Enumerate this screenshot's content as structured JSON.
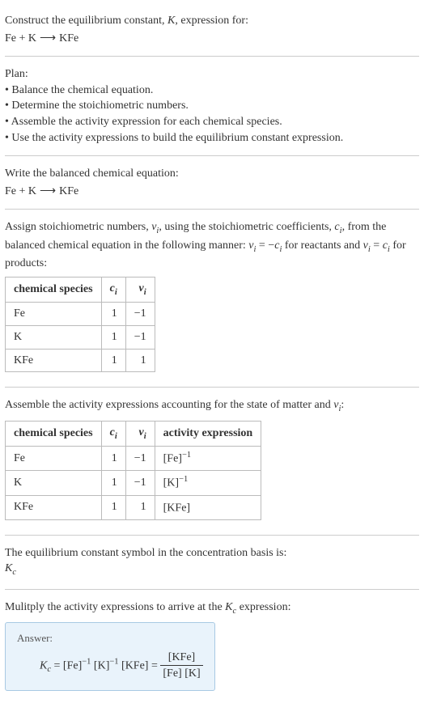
{
  "intro": {
    "line1_pre": "Construct the equilibrium constant, ",
    "line1_var": "K",
    "line1_post": ", expression for:",
    "eq_lhs1": "Fe",
    "eq_plus": " + ",
    "eq_lhs2": "K",
    "eq_arrow": "⟶",
    "eq_rhs": "KFe"
  },
  "plan": {
    "heading": "Plan:",
    "b1": "• Balance the chemical equation.",
    "b2": "• Determine the stoichiometric numbers.",
    "b3": "• Assemble the activity expression for each chemical species.",
    "b4": "• Use the activity expressions to build the equilibrium constant expression."
  },
  "balanced": {
    "heading": "Write the balanced chemical equation:",
    "eq_lhs1": "Fe",
    "eq_plus": " + ",
    "eq_lhs2": "K",
    "eq_arrow": "⟶",
    "eq_rhs": "KFe"
  },
  "stoich": {
    "text_a": "Assign stoichiometric numbers, ",
    "nu": "ν",
    "i": "i",
    "text_b": ", using the stoichiometric coefficients, ",
    "c": "c",
    "text_c": ", from the balanced chemical equation in the following manner: ",
    "rel1_lhs": "ν",
    "rel1_eq": " = −",
    "rel1_rhs": "c",
    "text_d": " for reactants and ",
    "rel2_lhs": "ν",
    "rel2_eq": " = ",
    "rel2_rhs": "c",
    "text_e": " for products:",
    "h_species": "chemical species",
    "h_c": "c",
    "h_nu": "ν",
    "rows": [
      {
        "sp": "Fe",
        "c": "1",
        "nu": "−1"
      },
      {
        "sp": "K",
        "c": "1",
        "nu": "−1"
      },
      {
        "sp": "KFe",
        "c": "1",
        "nu": "1"
      }
    ]
  },
  "activity": {
    "heading_a": "Assemble the activity expressions accounting for the state of matter and ",
    "heading_b": ":",
    "h_species": "chemical species",
    "h_c": "c",
    "h_nu": "ν",
    "h_act": "activity expression",
    "rows": [
      {
        "sp": "Fe",
        "c": "1",
        "nu": "−1",
        "act_base": "[Fe]",
        "act_exp": "−1"
      },
      {
        "sp": "K",
        "c": "1",
        "nu": "−1",
        "act_base": "[K]",
        "act_exp": "−1"
      },
      {
        "sp": "KFe",
        "c": "1",
        "nu": "1",
        "act_base": "[KFe]",
        "act_exp": ""
      }
    ]
  },
  "symbol": {
    "text": "The equilibrium constant symbol in the concentration basis is:",
    "Kc_K": "K",
    "Kc_c": "c"
  },
  "final": {
    "text_a": "Mulitply the activity expressions to arrive at the ",
    "text_b": " expression:",
    "answer_label": "Answer:",
    "Kc_K": "K",
    "Kc_c": "c",
    "eq": " = ",
    "t1_base": "[Fe]",
    "t1_exp": "−1",
    "sp": " ",
    "t2_base": "[K]",
    "t2_exp": "−1",
    "t3": "[KFe]",
    "frac_top": "[KFe]",
    "frac_bot": "[Fe] [K]"
  }
}
